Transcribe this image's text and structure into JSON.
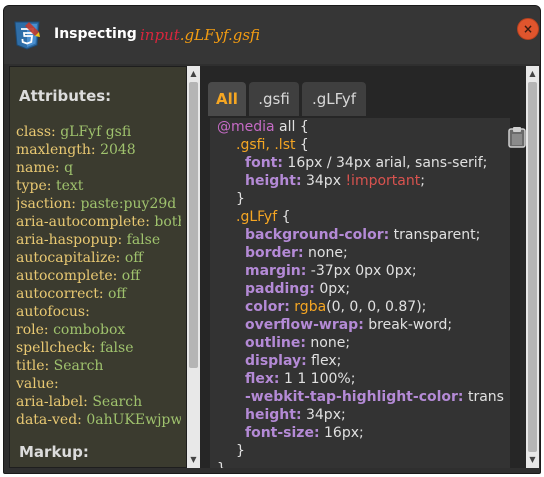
{
  "window": {
    "title": "Inspecting",
    "selector_tag": "input",
    "selector_rest": ".gLFyf.gsfi",
    "close_glyph": "×"
  },
  "icons": {
    "app": "css3-shield-icon",
    "close": "close-icon",
    "clipboard": "clipboard-icon",
    "scroll_up": "chevron-up-icon",
    "scroll_down": "chevron-down-icon"
  },
  "attributes": {
    "heading": "Attributes:",
    "items": [
      {
        "name": "class: ",
        "value": "gLFyf gsfi"
      },
      {
        "name": "maxlength: ",
        "value": "2048"
      },
      {
        "name": "name: ",
        "value": "q"
      },
      {
        "name": "type: ",
        "value": "text"
      },
      {
        "name": "jsaction: ",
        "value": "paste:puy29d"
      },
      {
        "name": "aria-autocomplete: ",
        "value": "both"
      },
      {
        "name": "aria-haspopup: ",
        "value": "false"
      },
      {
        "name": "autocapitalize: ",
        "value": "off"
      },
      {
        "name": "autocomplete: ",
        "value": "off"
      },
      {
        "name": "autocorrect: ",
        "value": "off"
      },
      {
        "name": "autofocus:",
        "value": ""
      },
      {
        "name": "role: ",
        "value": "combobox"
      },
      {
        "name": "spellcheck: ",
        "value": "false"
      },
      {
        "name": "title: ",
        "value": "Search"
      },
      {
        "name": "value:",
        "value": ""
      },
      {
        "name": "aria-label: ",
        "value": "Search"
      },
      {
        "name": "data-ved: ",
        "value": "0ahUKEwjpw"
      }
    ]
  },
  "markup": {
    "heading": "Markup:"
  },
  "tabs": [
    {
      "label": "All",
      "active": true
    },
    {
      "label": ".gsfi",
      "active": false
    },
    {
      "label": ".gLFyf",
      "active": false
    }
  ],
  "css_code": {
    "at_media": "@media",
    "media_query": " all {",
    "rule1_selector": ".gsfi, .lst",
    "rule1_open": " {",
    "font_prop": "font:",
    "font_val": " 16px / 34px arial, sans-serif;",
    "height_prop": "height:",
    "height_val": " 34px ",
    "important": "!important",
    "semicolon": ";",
    "rule1_close": "}",
    "rule2_selector": ".gLFyf",
    "rule2_open": " {",
    "decls": [
      {
        "prop": "background-color:",
        "val": " transparent;"
      },
      {
        "prop": "border:",
        "val": " none;"
      },
      {
        "prop": "margin:",
        "val": " -37px 0px 0px;"
      },
      {
        "prop": "padding:",
        "val": " 0px;"
      },
      {
        "prop": "color:",
        "fn": " rgba",
        "val": "(0, 0, 0, 0.87);"
      },
      {
        "prop": "overflow-wrap:",
        "val": " break-word;"
      },
      {
        "prop": "outline:",
        "val": " none;"
      },
      {
        "prop": "display:",
        "val": " flex;"
      },
      {
        "prop": "flex:",
        "val": " 1 1 100%;"
      },
      {
        "prop": "-webkit-tap-highlight-color:",
        "val": " trans"
      },
      {
        "prop": "height:",
        "val": " 34px;"
      },
      {
        "prop": "font-size:",
        "val": " 16px;"
      }
    ],
    "rule2_close": "}",
    "media_close": "}"
  },
  "colors": {
    "selector_tag": "#d7263d",
    "selector_rest": "#f39c12",
    "accent_tab": "#f5a623",
    "attr_name": "#e8c872",
    "attr_value": "#9fc26d",
    "css_property": "#b48ad6",
    "close_button": "#e0552d"
  }
}
